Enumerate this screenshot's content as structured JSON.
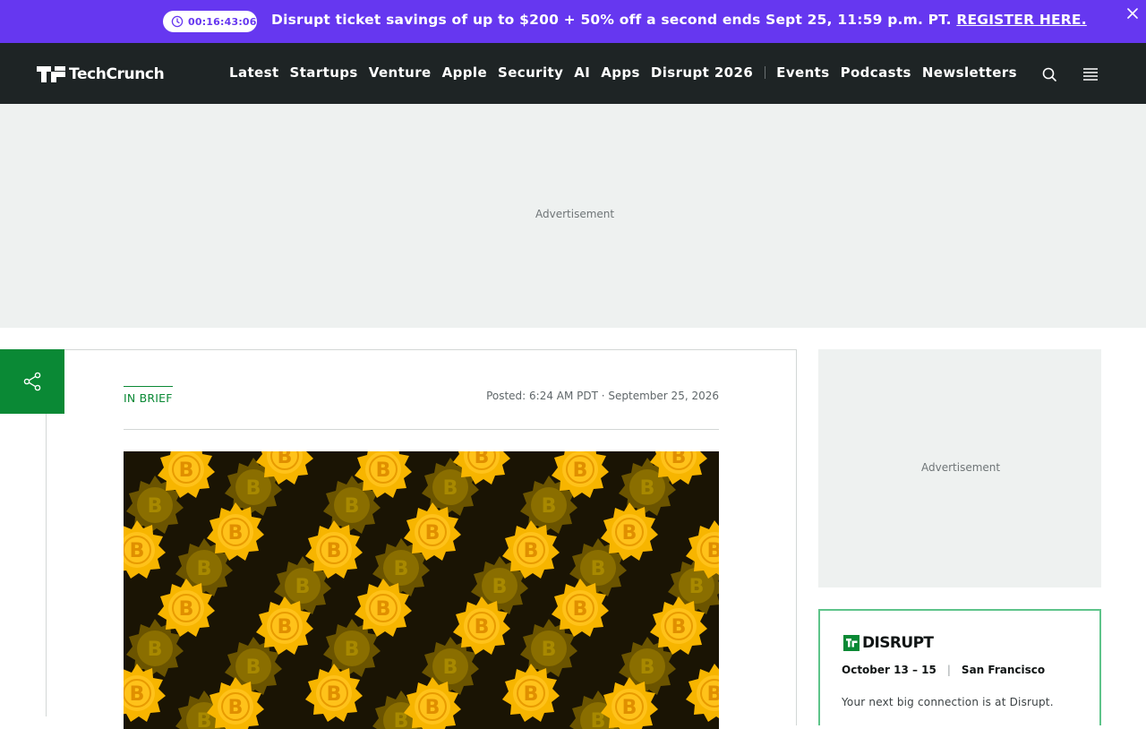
{
  "promo": {
    "timer": "00:16:43:06",
    "text": "Disrupt ticket savings of up to $200 + 50% off a second ends Sept 25, 11:59 p.m. PT.",
    "link": "REGISTER HERE.",
    "color": "#6637f0",
    "close_icon": "close-icon"
  },
  "nav": {
    "logo": "TechCrunch",
    "links_primary": [
      "Latest",
      "Startups",
      "Venture",
      "Apple",
      "Security",
      "AI",
      "Apps",
      "Disrupt 2026"
    ],
    "links_secondary": [
      "Events",
      "Podcasts",
      "Newsletters"
    ],
    "icons": [
      "search-icon",
      "menu-icon"
    ],
    "background": "#1e2425"
  },
  "ads": {
    "top_label": "Advertisement",
    "side_label": "Advertisement"
  },
  "share": {
    "icon": "share-icon",
    "color": "#0a8935"
  },
  "article": {
    "category": "IN BRIEF",
    "posted": "Posted: 6:24 AM PDT · September 25, 2026",
    "image_icon": "bitcoin-coins-pattern"
  },
  "sidebar": {
    "event_logo": "DISRUPT",
    "dates": "October 13 – 15",
    "location": "San Francisco",
    "tagline": "Your next big connection is at Disrupt.",
    "border_color": "#5ec48a"
  }
}
